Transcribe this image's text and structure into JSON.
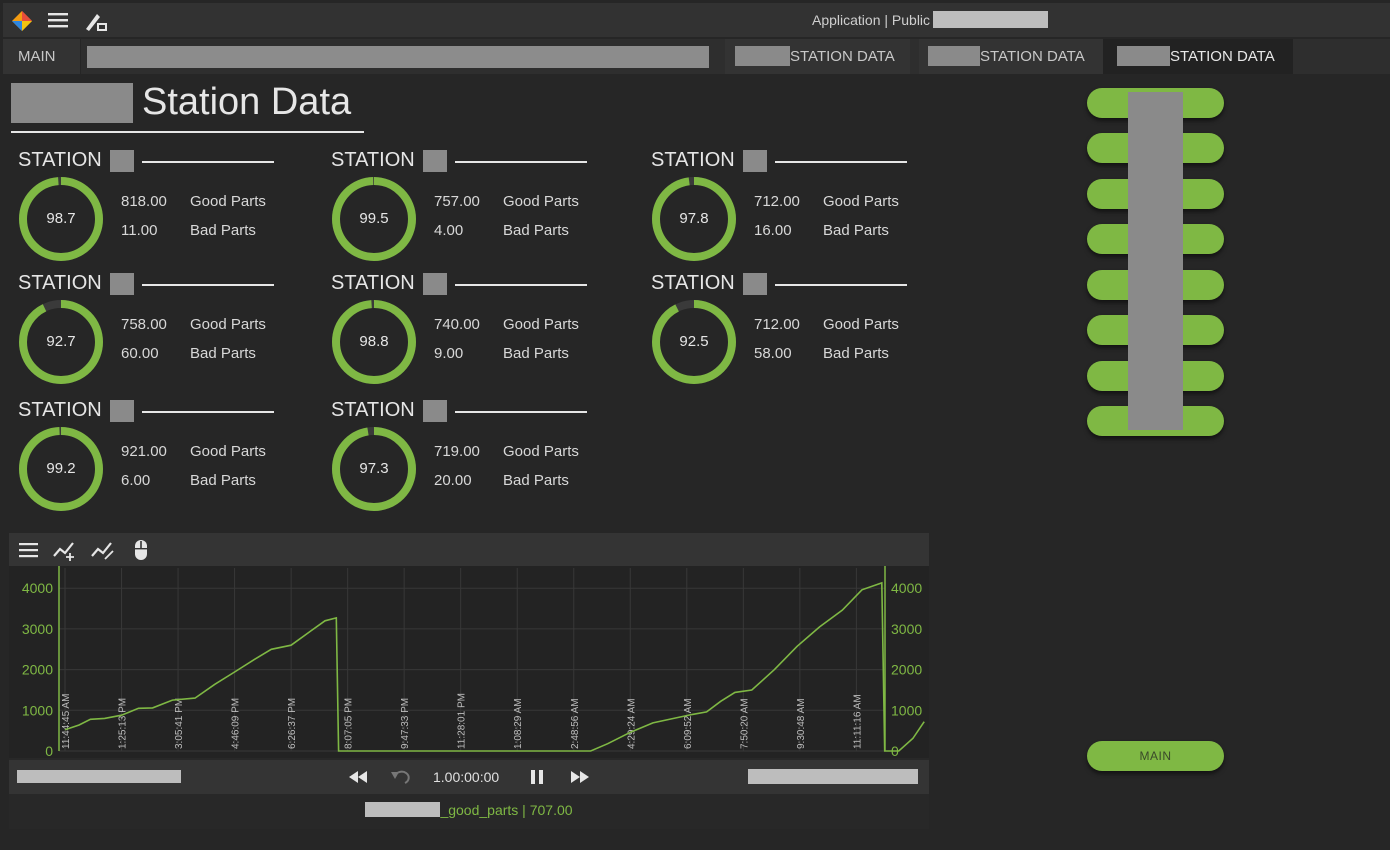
{
  "topbar": {
    "title": "Application | Public",
    "icons": [
      "logo-icon",
      "menu-icon",
      "designer-icon"
    ]
  },
  "tabs": {
    "main": "MAIN",
    "station_tabs": [
      "STATION DATA",
      "STATION DATA",
      "STATION DATA"
    ],
    "active_index": 2
  },
  "page": {
    "title": "Station Data"
  },
  "stations": [
    {
      "label": "STATION",
      "quality": "98.7",
      "quality_pct": 98.7,
      "good": "818.00",
      "bad": "11.00",
      "good_label": "Good Parts",
      "bad_label": "Bad Parts"
    },
    {
      "label": "STATION",
      "quality": "99.5",
      "quality_pct": 99.5,
      "good": "757.00",
      "bad": "4.00",
      "good_label": "Good Parts",
      "bad_label": "Bad Parts"
    },
    {
      "label": "STATION",
      "quality": "97.8",
      "quality_pct": 97.8,
      "good": "712.00",
      "bad": "16.00",
      "good_label": "Good Parts",
      "bad_label": "Bad Parts"
    },
    {
      "label": "STATION",
      "quality": "92.7",
      "quality_pct": 92.7,
      "good": "758.00",
      "bad": "60.00",
      "good_label": "Good Parts",
      "bad_label": "Bad Parts"
    },
    {
      "label": "STATION",
      "quality": "98.8",
      "quality_pct": 98.8,
      "good": "740.00",
      "bad": "9.00",
      "good_label": "Good Parts",
      "bad_label": "Bad Parts"
    },
    {
      "label": "STATION",
      "quality": "92.5",
      "quality_pct": 92.5,
      "good": "712.00",
      "bad": "58.00",
      "good_label": "Good Parts",
      "bad_label": "Bad Parts"
    },
    {
      "label": "STATION",
      "quality": "99.2",
      "quality_pct": 99.2,
      "good": "921.00",
      "bad": "6.00",
      "good_label": "Good Parts",
      "bad_label": "Bad Parts"
    },
    {
      "label": "STATION",
      "quality": "97.3",
      "quality_pct": 97.3,
      "good": "719.00",
      "bad": "20.00",
      "good_label": "Good Parts",
      "bad_label": "Bad Parts"
    }
  ],
  "nav": {
    "main_label": "MAIN"
  },
  "colors": {
    "accent": "#7fb844",
    "gauge_track": "#3a3a3a"
  },
  "chart_toolbar": {
    "icons": [
      "menu-icon",
      "add-pen-icon",
      "remove-pen-icon",
      "mouse-icon"
    ]
  },
  "playback": {
    "speed": "1.00:00:00",
    "icons": [
      "rewind-icon",
      "undo-icon",
      "pause-icon",
      "fast-forward-icon"
    ]
  },
  "legend": {
    "text": "_good_parts | 707.00"
  },
  "chart_data": {
    "type": "line",
    "title": "",
    "xlabel": "",
    "ylabel": "",
    "ylim": [
      0,
      4300
    ],
    "y_ticks": [
      "4000",
      "3000",
      "2000",
      "1000",
      "0"
    ],
    "y_tick_values": [
      4000,
      3000,
      2000,
      1000,
      0
    ],
    "x_ticks": [
      "11:44:45 AM",
      "1:25:13 PM",
      "3:05:41 PM",
      "4:46:09 PM",
      "6:26:37 PM",
      "8:07:05 PM",
      "9:47:33 PM",
      "11:28:01 PM",
      "1:08:29 AM",
      "2:48:56 AM",
      "4:29:24 AM",
      "6:09:52 AM",
      "7:50:20 AM",
      "9:30:48 AM",
      "11:11:16 AM"
    ],
    "grid": true,
    "series": [
      {
        "name": "",
        "color": "#7fb844",
        "points": [
          [
            0.0,
            520
          ],
          [
            0.25,
            640
          ],
          [
            0.45,
            780
          ],
          [
            0.7,
            800
          ],
          [
            1.0,
            880
          ],
          [
            1.3,
            1050
          ],
          [
            1.55,
            1060
          ],
          [
            1.9,
            1250
          ],
          [
            2.3,
            1300
          ],
          [
            2.65,
            1640
          ],
          [
            3.0,
            1940
          ],
          [
            3.35,
            2250
          ],
          [
            3.65,
            2500
          ],
          [
            4.0,
            2600
          ],
          [
            4.35,
            2950
          ],
          [
            4.6,
            3200
          ],
          [
            4.8,
            3270
          ],
          [
            4.84,
            0
          ],
          [
            9.3,
            0
          ],
          [
            9.6,
            180
          ],
          [
            10.0,
            460
          ],
          [
            10.4,
            690
          ],
          [
            10.8,
            810
          ],
          [
            11.1,
            900
          ],
          [
            11.35,
            960
          ],
          [
            11.6,
            1220
          ],
          [
            11.85,
            1440
          ],
          [
            12.15,
            1500
          ],
          [
            12.55,
            2000
          ],
          [
            12.95,
            2570
          ],
          [
            13.35,
            3050
          ],
          [
            13.75,
            3460
          ],
          [
            14.1,
            3960
          ],
          [
            14.45,
            4130
          ],
          [
            14.5,
            0
          ],
          [
            14.75,
            0
          ],
          [
            15.0,
            310
          ],
          [
            15.2,
            720
          ]
        ]
      }
    ]
  }
}
